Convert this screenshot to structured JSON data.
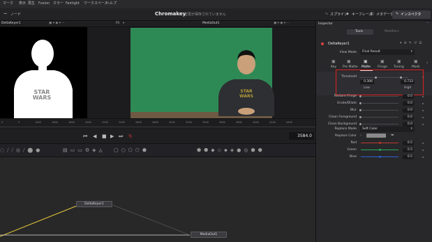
{
  "menu": {
    "items": [
      "マーク",
      "表示",
      "再生",
      "Fusion",
      "カラー",
      "Fairlight",
      "ワークスペース",
      "ヘルプ"
    ]
  },
  "toolbar": {
    "node_label": "ノード",
    "title": "Chromakey",
    "subtitle": "変更が保存されていません",
    "spline_label": "スプライン",
    "keyframe_label": "キーフレーム",
    "metadata_label": "メタデータ",
    "inspector_label": "インスペクタ"
  },
  "viewers": {
    "left_title": "DeltaKeyer1",
    "fit_label": "Fit",
    "right_title": "MediaOut1"
  },
  "timeline": {
    "ticks": [
      "0",
      "5",
      "1400",
      "1600",
      "1800",
      "2000",
      "2200",
      "2400",
      "2600",
      "2800",
      "3000",
      "3200",
      "3400",
      "3600",
      "3800",
      "4000",
      "4200",
      "4400"
    ]
  },
  "transport": {
    "timecode": "3584.0"
  },
  "nodes": {
    "delta": "DeltaKeyer1",
    "media_out": "MediaOut1"
  },
  "inspector": {
    "title": "Inspector",
    "tab_tools": "Tools",
    "tab_modifiers": "Modifiers",
    "node_name": "DeltaKeyer1",
    "view_mode_label": "View Mode",
    "view_mode_value": "Final Result",
    "subtabs": [
      "Key",
      "Pre Matte",
      "Matte",
      "Fringe",
      "Tuning",
      "Mask"
    ],
    "threshold_label": "Threshold",
    "threshold_low": "0.306",
    "threshold_high": "0.733",
    "low_label": "Low",
    "high_label": "High",
    "params": [
      {
        "label": "Restore Fringe",
        "value": "0.0"
      },
      {
        "label": "Erode/Dilate",
        "value": "0.0"
      },
      {
        "label": "Blur",
        "value": "0.0"
      },
      {
        "label": "Clean Foreground",
        "value": "0.0"
      },
      {
        "label": "Clean Background",
        "value": "0.0"
      }
    ],
    "replace_mode_label": "Replace Mode",
    "replace_mode_value": "Soft Color",
    "replace_color_label": "Replace Color",
    "rgb": [
      {
        "label": "Red",
        "value": "0.5",
        "color": "#c0392b"
      },
      {
        "label": "Green",
        "value": "0.5",
        "color": "#27ae60"
      },
      {
        "label": "Blue",
        "value": "0.5",
        "color": "#2e5fd0"
      }
    ]
  },
  "overlay": {
    "highlight_color": "#e02020",
    "green_screen": "#2e8a55",
    "node_link_color": "#e8c93a"
  }
}
